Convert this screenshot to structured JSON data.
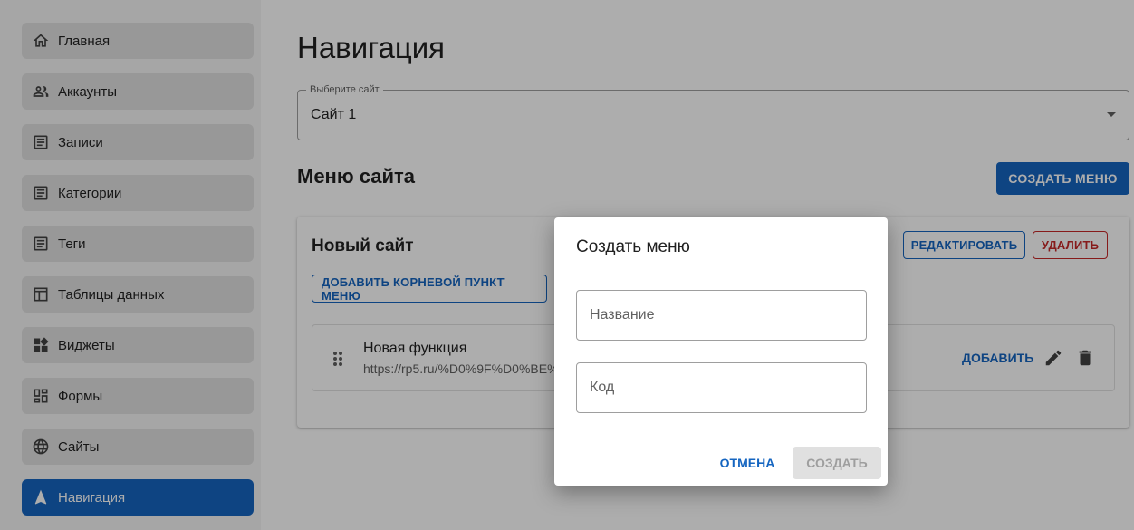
{
  "sidebar": {
    "items": [
      {
        "label": "Главная",
        "icon": "home-icon"
      },
      {
        "label": "Аккаунты",
        "icon": "people-icon"
      },
      {
        "label": "Записи",
        "icon": "article-icon"
      },
      {
        "label": "Категории",
        "icon": "article-icon"
      },
      {
        "label": "Теги",
        "icon": "article-icon"
      },
      {
        "label": "Таблицы данных",
        "icon": "table-icon"
      },
      {
        "label": "Виджеты",
        "icon": "widgets-icon"
      },
      {
        "label": "Формы",
        "icon": "dashboard-icon"
      },
      {
        "label": "Сайты",
        "icon": "globe-icon"
      },
      {
        "label": "Навигация",
        "icon": "navigation-icon",
        "active": true
      }
    ]
  },
  "main": {
    "title": "Навигация",
    "site_select": {
      "label": "Выберите сайт",
      "value": "Сайт 1"
    },
    "section_title": "Меню сайта",
    "create_menu_button": "СОЗДАТЬ МЕНЮ",
    "card": {
      "title": "Новый сайт",
      "edit_button": "РЕДАКТИРОВАТЬ",
      "delete_button": "УДАЛИТЬ",
      "add_root_button": "ДОБАВИТЬ КОРНЕВОЙ ПУНКТ МЕНЮ",
      "item": {
        "title": "Новая функция",
        "url": "https://rp5.ru/%D0%9F%D0%BE%",
        "add_label": "ДОБАВИТЬ"
      }
    }
  },
  "dialog": {
    "title": "Создать меню",
    "name_placeholder": "Название",
    "code_placeholder": "Код",
    "cancel_label": "ОТМЕНА",
    "create_label": "СОЗДАТЬ"
  },
  "colors": {
    "primary": "#1565c0",
    "danger": "#c62828",
    "sidebar_bg": "#f5f5f5",
    "nav_item_bg": "#e0e0e0"
  }
}
